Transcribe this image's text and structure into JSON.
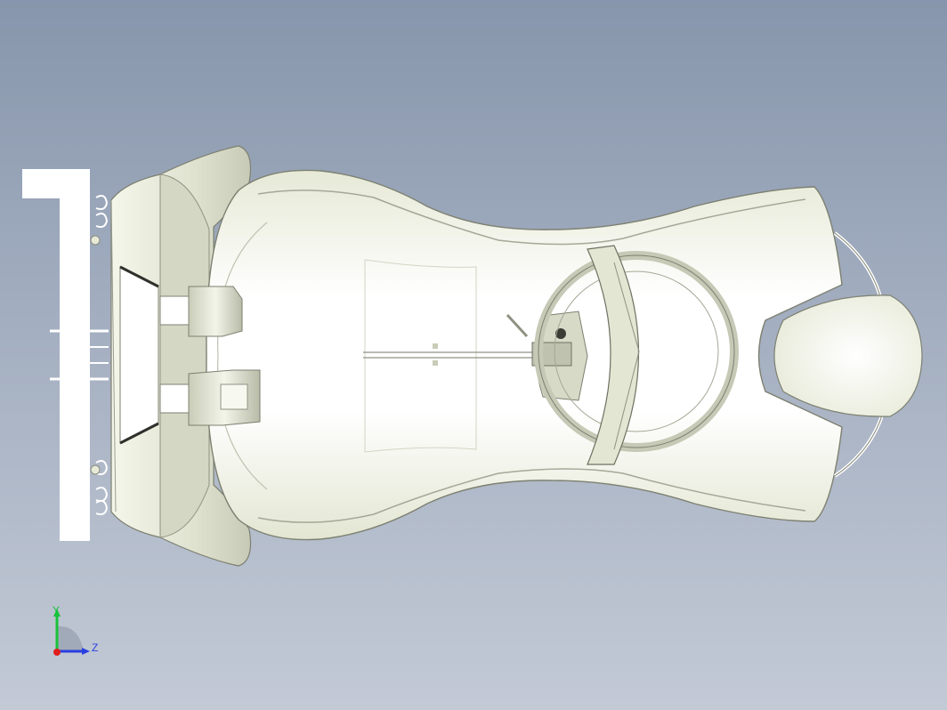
{
  "viewport": {
    "background_top": "#8796ac",
    "background_bottom": "#c3cad6",
    "model_color": "#f2f4e6",
    "model_edge_color": "#7d8070"
  },
  "triad": {
    "y_label": "Y",
    "z_label": "Z",
    "y_color": "#19c23a",
    "z_color": "#2a3fe0",
    "x_color": "#e01e1e"
  }
}
